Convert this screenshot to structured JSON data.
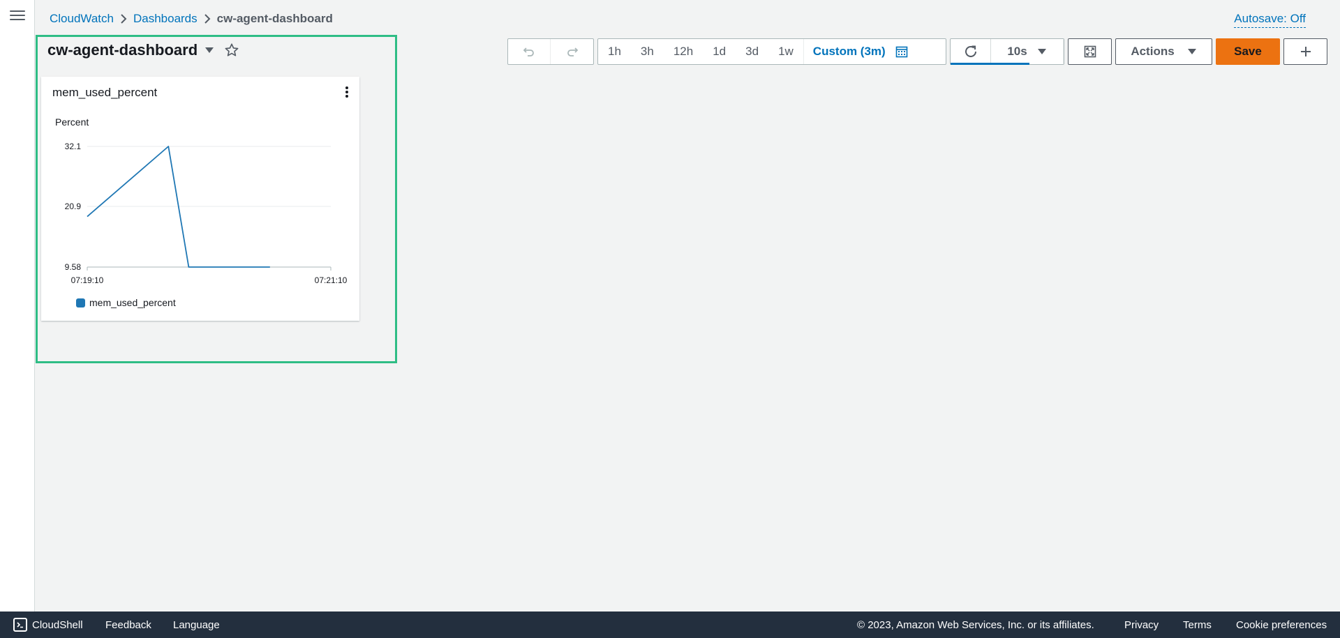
{
  "breadcrumb": {
    "items": [
      "CloudWatch",
      "Dashboards"
    ],
    "current": "cw-agent-dashboard"
  },
  "autosave_label": "Autosave: Off",
  "dashboard": {
    "title": "cw-agent-dashboard"
  },
  "toolbar": {
    "ranges": [
      "1h",
      "3h",
      "12h",
      "1d",
      "3d",
      "1w"
    ],
    "custom_label": "Custom (3m)",
    "refresh_interval": "10s",
    "actions_label": "Actions",
    "save_label": "Save"
  },
  "widget": {
    "title": "mem_used_percent",
    "legend_label": "mem_used_percent"
  },
  "chart_data": {
    "type": "line",
    "ylabel": "Percent",
    "y_ticks": [
      "32.1",
      "20.9",
      "9.58"
    ],
    "ylim": [
      9.58,
      32.1
    ],
    "x_ticks": [
      "07:19:10",
      "07:21:10"
    ],
    "series": [
      {
        "name": "mem_used_percent",
        "color": "#1f77b4",
        "x": [
          "07:19:10",
          "07:19:50",
          "07:20:00",
          "07:20:40"
        ],
        "values": [
          19.0,
          32.1,
          9.58,
          9.58
        ]
      }
    ],
    "grid": true,
    "legend": "bottom-left"
  },
  "footer": {
    "cloudshell": "CloudShell",
    "feedback": "Feedback",
    "language": "Language",
    "copyright": "© 2023, Amazon Web Services, Inc. or its affiliates.",
    "privacy": "Privacy",
    "terms": "Terms",
    "cookies": "Cookie preferences"
  },
  "colors": {
    "link": "#0073bb",
    "save_button": "#ec7211",
    "highlight_border": "#2fbd85",
    "footer_bg": "#232f3e"
  }
}
